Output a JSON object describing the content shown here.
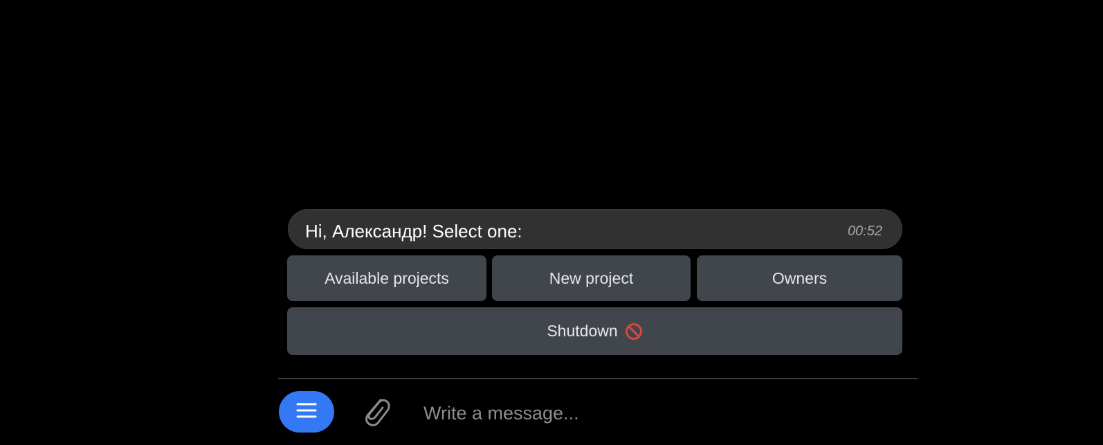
{
  "message": {
    "text": "Hi, Александр! Select one:",
    "time": "00:52"
  },
  "keyboard": {
    "available_projects": "Available projects",
    "new_project": "New project",
    "owners": "Owners",
    "shutdown": "Shutdown"
  },
  "composer": {
    "placeholder": "Write a message..."
  },
  "icons": {
    "menu": "menu-icon",
    "attach": "paperclip-icon",
    "shutdown": "prohibited-icon"
  },
  "colors": {
    "background": "#000000",
    "bubble": "#313131",
    "button": "#41464d",
    "accent": "#3478f6",
    "prohibited": "#e0453a"
  }
}
